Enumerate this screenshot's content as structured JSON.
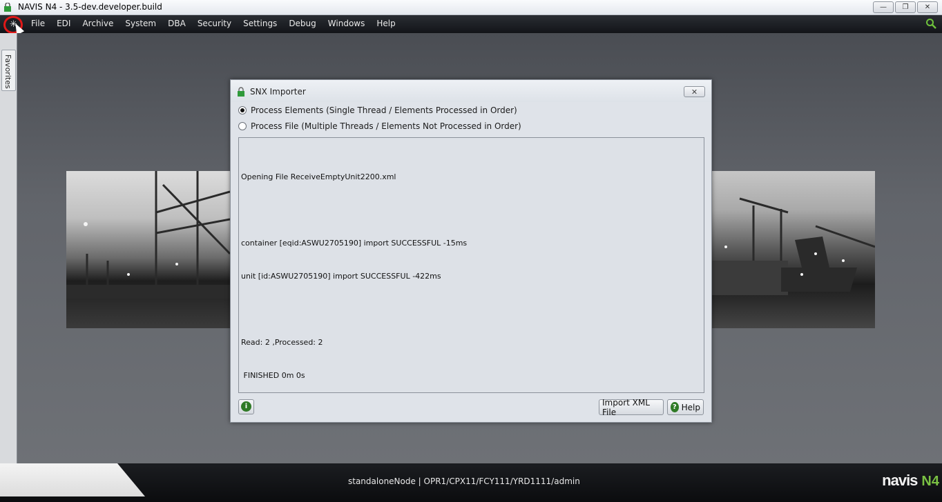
{
  "window": {
    "title": "NAVIS N4 - 3.5-dev.developer.build",
    "controls": {
      "minimize": "—",
      "restore": "❐",
      "close": "✕"
    }
  },
  "menubar": {
    "items": [
      "File",
      "EDI",
      "Archive",
      "System",
      "DBA",
      "Security",
      "Settings",
      "Debug",
      "Windows",
      "Help"
    ]
  },
  "sidebar": {
    "favorites_label": "Favorites"
  },
  "dialog": {
    "title": "SNX Importer",
    "close_glyph": "✕",
    "options": [
      {
        "label": "Process Elements (Single Thread / Elements Processed in Order)",
        "checked": true
      },
      {
        "label": "Process File (Multiple Threads / Elements Not Processed in Order)",
        "checked": false
      }
    ],
    "log_lines": [
      "Opening File ReceiveEmptyUnit2200.xml",
      "",
      "container [eqid:ASWU2705190] import SUCCESSFUL -15ms",
      "unit [id:ASWU2705190] import SUCCESSFUL -422ms",
      "",
      "Read: 2 ,Processed: 2",
      " FINISHED 0m 0s"
    ],
    "info_glyph": "i",
    "import_button": "Import XML File",
    "help_button": "Help",
    "help_glyph": "?"
  },
  "statusbar": {
    "text": "standaloneNode | OPR1/CPX11/FCY111/YRD1111/admin",
    "brand": "navis",
    "brand_suffix": "N4"
  },
  "colors": {
    "accent_green": "#7ac143",
    "close_ring": "#e01818",
    "info_green": "#2f7a26"
  }
}
